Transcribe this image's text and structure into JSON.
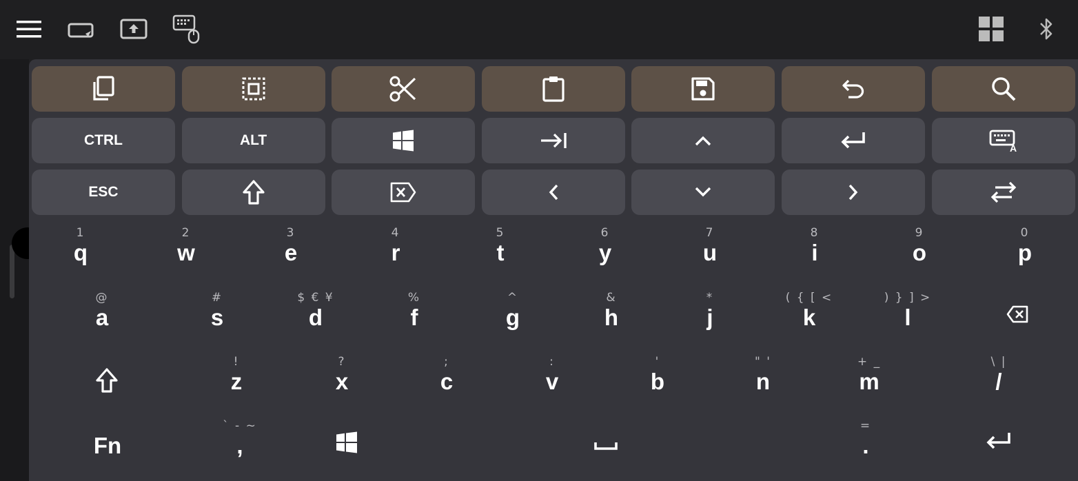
{
  "topbar": {
    "icons": [
      "menu-icon",
      "keyboard-mouse-toggle-icon",
      "screen-share-icon",
      "keyboard-mouse-icon",
      "grid-view-icon",
      "bluetooth-icon"
    ]
  },
  "function_rows": [
    [
      {
        "name": "copy-button",
        "icon": "copy-icon",
        "label": ""
      },
      {
        "name": "select-all-button",
        "icon": "select-all-icon",
        "label": ""
      },
      {
        "name": "cut-button",
        "icon": "scissors-icon",
        "label": ""
      },
      {
        "name": "paste-button",
        "icon": "clipboard-icon",
        "label": ""
      },
      {
        "name": "save-button",
        "icon": "save-icon",
        "label": ""
      },
      {
        "name": "undo-button",
        "icon": "undo-icon",
        "label": ""
      },
      {
        "name": "search-button",
        "icon": "search-icon",
        "label": ""
      }
    ],
    [
      {
        "name": "ctrl-key",
        "icon": "",
        "label": "CTRL"
      },
      {
        "name": "alt-key",
        "icon": "",
        "label": "ALT"
      },
      {
        "name": "windows-key",
        "icon": "windows-icon",
        "label": ""
      },
      {
        "name": "tab-key",
        "icon": "tab-icon",
        "label": ""
      },
      {
        "name": "up-arrow-key",
        "icon": "chevron-up-icon",
        "label": ""
      },
      {
        "name": "enter-key",
        "icon": "enter-icon",
        "label": ""
      },
      {
        "name": "keyboard-layout-key",
        "icon": "keyboard-a-icon",
        "label": ""
      }
    ],
    [
      {
        "name": "esc-key",
        "icon": "",
        "label": "ESC"
      },
      {
        "name": "shift-key",
        "icon": "shift-icon",
        "label": ""
      },
      {
        "name": "delete-key",
        "icon": "delete-icon",
        "label": ""
      },
      {
        "name": "left-arrow-key",
        "icon": "chevron-left-icon",
        "label": ""
      },
      {
        "name": "down-arrow-key",
        "icon": "chevron-down-icon",
        "label": ""
      },
      {
        "name": "right-arrow-key",
        "icon": "chevron-right-icon",
        "label": ""
      },
      {
        "name": "swap-key",
        "icon": "swap-arrows-icon",
        "label": ""
      }
    ]
  ],
  "letter_rows": [
    [
      {
        "hint": "1",
        "main": "q"
      },
      {
        "hint": "2",
        "main": "w"
      },
      {
        "hint": "3",
        "main": "e"
      },
      {
        "hint": "4",
        "main": "r"
      },
      {
        "hint": "5",
        "main": "t"
      },
      {
        "hint": "6",
        "main": "y"
      },
      {
        "hint": "7",
        "main": "u"
      },
      {
        "hint": "8",
        "main": "i"
      },
      {
        "hint": "9",
        "main": "o"
      },
      {
        "hint": "0",
        "main": "p"
      }
    ],
    [
      {
        "hint": "@",
        "main": "a"
      },
      {
        "hint": "#",
        "main": "s"
      },
      {
        "hint": "$ € ¥",
        "main": "d"
      },
      {
        "hint": "%",
        "main": "f"
      },
      {
        "hint": "^",
        "main": "g"
      },
      {
        "hint": "&",
        "main": "h"
      },
      {
        "hint": "*",
        "main": "j"
      },
      {
        "hint": "( { [ <",
        "main": "k"
      },
      {
        "hint": ") } ] >",
        "main": "l"
      },
      {
        "hint": "",
        "main": "",
        "icon": "backspace-icon"
      }
    ],
    [
      {
        "hint": "",
        "main": "",
        "icon": "shift-icon"
      },
      {
        "hint": "!",
        "main": "z"
      },
      {
        "hint": "?",
        "main": "x"
      },
      {
        "hint": ";",
        "main": "c"
      },
      {
        "hint": ":",
        "main": "v"
      },
      {
        "hint": "'",
        "main": "b"
      },
      {
        "hint": "\" '",
        "main": "n"
      },
      {
        "hint": "+ _",
        "main": "m"
      },
      {
        "hint": "\\ |",
        "main": "/"
      }
    ],
    [
      {
        "hint": "",
        "main": "Fn"
      },
      {
        "hint": "` - ~",
        "main": ","
      },
      {
        "hint": "",
        "main": "",
        "icon": "windows-icon"
      },
      {
        "hint": "",
        "main": "",
        "icon": "spacebar-icon"
      },
      {
        "hint": "=",
        "main": "."
      },
      {
        "hint": "",
        "main": "",
        "icon": "enter-icon"
      }
    ]
  ],
  "colors": {
    "background": "#1f1f21",
    "keyboard": "#35353b",
    "function_key_brown": "#5d5147",
    "function_key_gray": "#4a4a51",
    "hint_text": "#b9b9bd"
  }
}
